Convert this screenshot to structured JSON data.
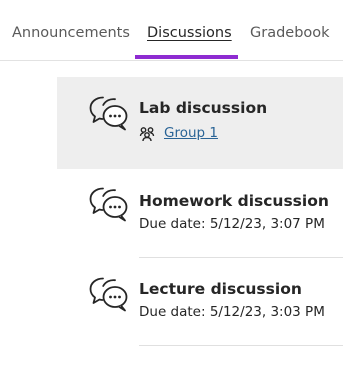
{
  "tabs": [
    {
      "label": "Announcements",
      "active": false
    },
    {
      "label": "Discussions",
      "active": true
    },
    {
      "label": "Gradebook",
      "active": false
    }
  ],
  "colors": {
    "accent": "#8e2bd1",
    "selected_row_bg": "#eeeeee",
    "link": "#2a6496",
    "text": "#262626"
  },
  "discussions": [
    {
      "title": "Lab discussion",
      "group_icon": "group-icon",
      "group_label": "Group 1",
      "icon": "discussion-icon",
      "selected": true
    },
    {
      "title": "Homework discussion",
      "due": "Due date: 5/12/23, 3:07 PM",
      "icon": "discussion-icon",
      "selected": false
    },
    {
      "title": "Lecture discussion",
      "due": "Due date: 5/12/23, 3:03 PM",
      "icon": "discussion-icon",
      "selected": false
    }
  ]
}
